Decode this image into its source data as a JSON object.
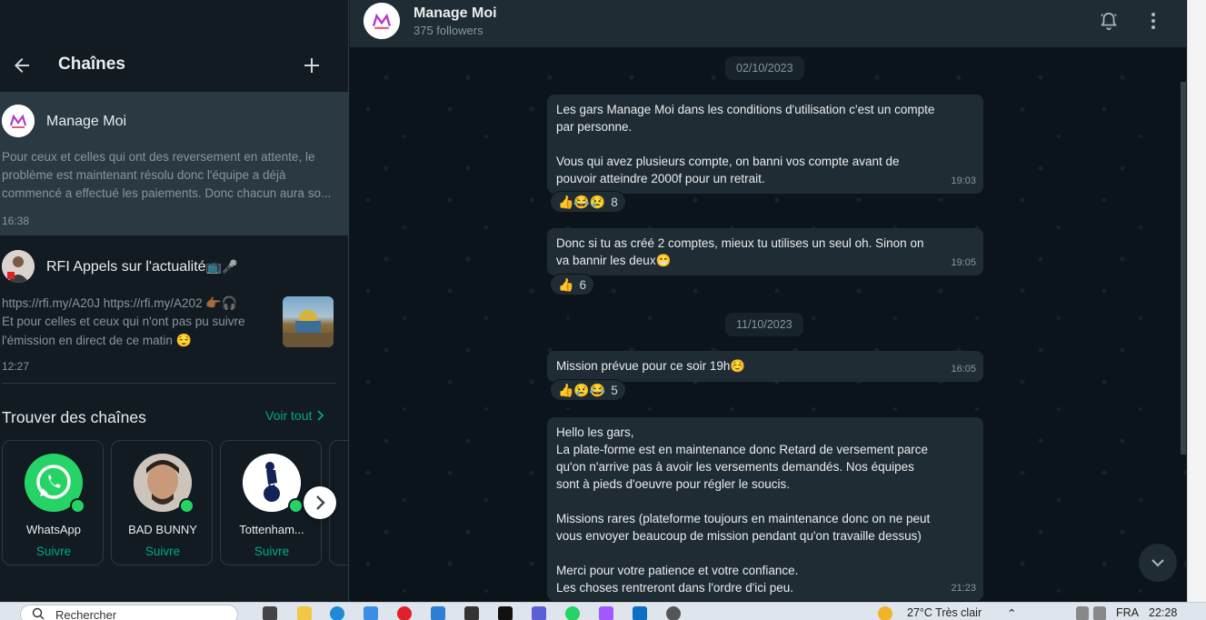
{
  "left_panel": {
    "title": "Chaînes",
    "channels": [
      {
        "name": "Manage Moi",
        "message": "Pour ceux et celles qui ont des reversement en attente, le problème est maintenant résolu donc l'équipe a déjà commencé a effectué les paiements. Donc chacun aura so...",
        "time": "16:38"
      },
      {
        "name": "RFI Appels sur l'actualité",
        "message_line1": "https://rfi.my/A20J    https://rfi.my/A202",
        "message_line2": "Et pour celles et ceux qui n'ont pas pu suivre l'émission en direct de ce matin",
        "time": "12:27"
      }
    ],
    "find": {
      "title": "Trouver des chaînes",
      "see_all": "Voir tout",
      "cards": [
        {
          "name": "WhatsApp",
          "follow": "Suivre"
        },
        {
          "name": "BAD BUNNY",
          "follow": "Suivre"
        },
        {
          "name": "Tottenham...",
          "follow": "Suivre"
        }
      ]
    }
  },
  "chat": {
    "name": "Manage Moi",
    "followers": "375 followers",
    "dates": [
      "02/10/2023",
      "11/10/2023"
    ],
    "messages": [
      {
        "text": "Les gars Manage Moi dans les conditions d'utilisation c'est un compte par personne.\n\nVous qui avez plusieurs compte, on banni vos compte avant de pouvoir atteindre 2000f pour un retrait.",
        "time": "19:03",
        "reaction_emojis": "👍😂😢",
        "reaction_count": "8"
      },
      {
        "text": "Donc si tu as créé 2 comptes, mieux tu utilises un seul oh. Sinon on va bannir les deux😁",
        "time": "19:05",
        "reaction_emojis": "👍",
        "reaction_count": "6"
      },
      {
        "text": "Mission prévue pour ce soir 19h☺️",
        "time": "16:05",
        "reaction_emojis": "👍😢😂",
        "reaction_count": "5"
      },
      {
        "text": "Hello les gars,\nLa plate-forme est en maintenance donc Retard de versement parce qu'on n'arrive pas à avoir les versements demandés. Nos équipes sont à pieds d'oeuvre pour régler le soucis.\n\nMissions rares (plateforme toujours en maintenance donc on ne peut vous envoyer beaucoup de mission pendant qu'on travaille dessus)\n\nMerci pour votre patience et votre confiance.\nLes choses rentreront dans l'ordre d'ici peu.",
        "time": "21:23"
      }
    ]
  },
  "taskbar": {
    "search_placeholder": "Rechercher",
    "weather": "27°C  Très clair",
    "language": "FRA",
    "clock": "22:28"
  },
  "colors": {
    "accent": "#00a884",
    "bubble": "#202c33",
    "background": "#0b141a",
    "panel": "#111b21"
  }
}
